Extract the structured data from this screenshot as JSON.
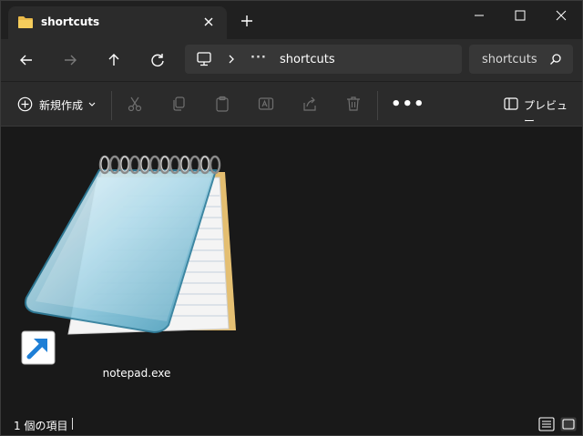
{
  "window": {
    "tab_title": "shortcuts",
    "colors": {
      "background": "#191919",
      "chrome": "#2b2b2b",
      "accent": "#ffffff"
    }
  },
  "nav": {
    "address_overflow": "···",
    "address_segment": "shortcuts",
    "search_value": "shortcuts"
  },
  "commandbar": {
    "new_label": "新規作成",
    "more_label": "•••",
    "preview_label": "プレビュー"
  },
  "files": [
    {
      "name": "notepad.exe",
      "icon": "notepad-shortcut-icon"
    }
  ],
  "status": {
    "item_count": "1 個の項目"
  }
}
